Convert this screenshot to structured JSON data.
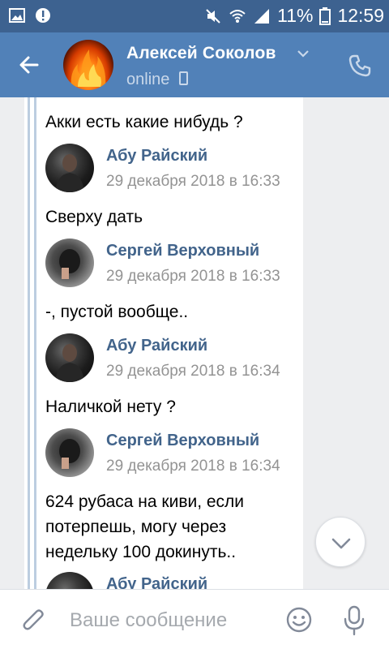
{
  "status_bar": {
    "battery_percent": "11%",
    "time": "12:59"
  },
  "header": {
    "contact_name": "Алексей Соколов",
    "presence": "online"
  },
  "messages": [
    {
      "text": "Акки есть какие нибудь ?"
    },
    {
      "author": "Абу Райский",
      "date": "29 декабря 2018 в 16:33",
      "text": "Сверху дать"
    },
    {
      "author": "Сергей Верховный",
      "date": "29 декабря 2018 в 16:33",
      "text": "-, пустой вообще.."
    },
    {
      "author": "Абу Райский",
      "date": "29 декабря 2018 в 16:34",
      "text": "Наличкой нету ?"
    },
    {
      "author": "Сергей Верховный",
      "date": "29 декабря 2018 в 16:34",
      "text_lines": [
        "624 рубаса на киви, если",
        "потерпешь, могу через",
        "недельку 100 докинуть.."
      ]
    },
    {
      "author": "Абу Райский"
    }
  ],
  "input": {
    "placeholder": "Ваше сообщение",
    "value": ""
  },
  "colors": {
    "status_bar": "#3d6290",
    "header": "#5181b8",
    "author_name": "#42648b",
    "forward_rail": "#bccde0"
  },
  "icons": {
    "back": "arrow-left-icon",
    "call": "phone-icon",
    "attach": "paperclip-icon",
    "emoji": "smiley-icon",
    "mic": "microphone-icon",
    "scroll": "chevron-down-icon"
  }
}
